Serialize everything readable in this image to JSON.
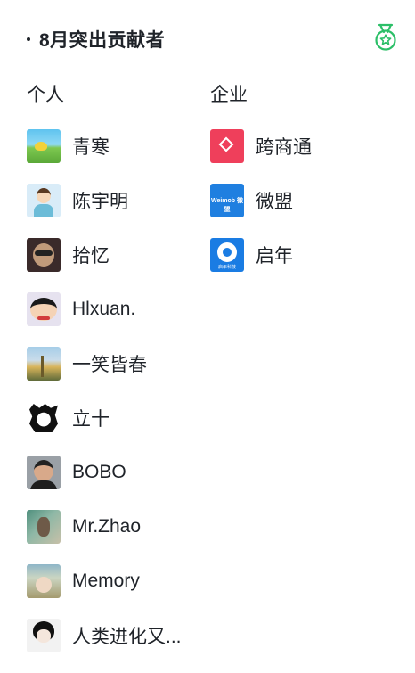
{
  "header": {
    "title": "8月突出贡献者",
    "icon": "medal-star-icon",
    "accent_color": "#2cbf68"
  },
  "columns": {
    "person_label": "个人",
    "company_label": "企业"
  },
  "persons": [
    {
      "name": "青寒",
      "avatar": "landscape-cartoon-avatar"
    },
    {
      "name": "陈宇明",
      "avatar": "cartoon-boy-avatar"
    },
    {
      "name": "拾忆",
      "avatar": "glasses-person-avatar"
    },
    {
      "name": "Hlxuan.",
      "avatar": "crayon-shin-chan-avatar"
    },
    {
      "name": "一笑皆春",
      "avatar": "flower-field-avatar"
    },
    {
      "name": "立十",
      "avatar": "anime-sketch-avatar"
    },
    {
      "name": "BOBO",
      "avatar": "person-photo-avatar"
    },
    {
      "name": "Mr.Zhao",
      "avatar": "bird-photo-avatar"
    },
    {
      "name": "Memory",
      "avatar": "outdoor-photo-avatar"
    },
    {
      "name": "人类进化又...",
      "avatar": "anime-boy-avatar"
    }
  ],
  "companies": [
    {
      "name": "跨商通",
      "logo": "red-diamond-logo"
    },
    {
      "name": "微盟",
      "logo": "weimob-logo",
      "logo_text": "Weimob 微盟"
    },
    {
      "name": "启年",
      "logo": "qinian-logo",
      "logo_text": "启年科技"
    }
  ]
}
